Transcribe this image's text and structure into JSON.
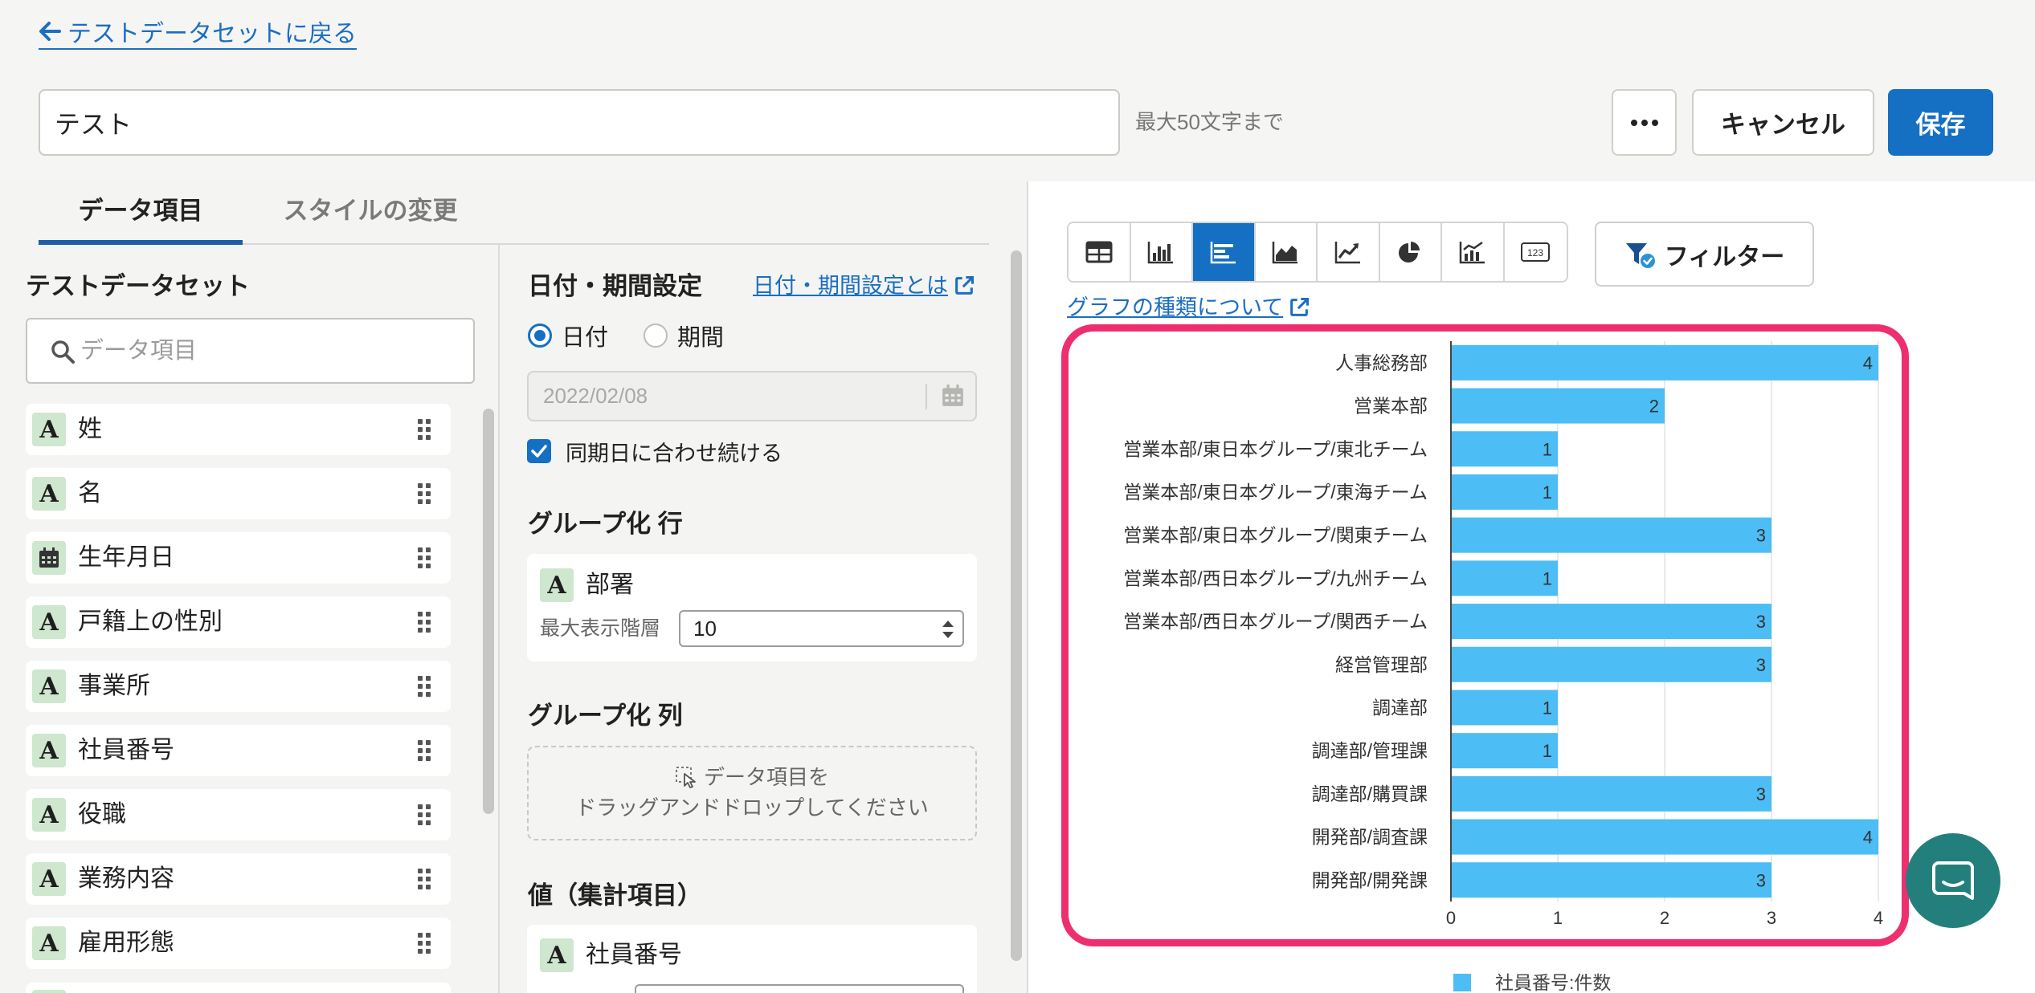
{
  "header": {
    "back_link": "テストデータセットに戻る",
    "title_value": "テスト",
    "title_hint": "最大50文字まで",
    "cancel_label": "キャンセル",
    "save_label": "保存"
  },
  "tabs": [
    {
      "label": "データ項目",
      "active": true
    },
    {
      "label": "スタイルの変更",
      "active": false
    }
  ],
  "dataset": {
    "title": "テストデータセット",
    "search_placeholder": "データ項目",
    "icon_letter": "A",
    "fields": [
      {
        "label": "姓",
        "icon": "text-type-icon"
      },
      {
        "label": "名",
        "icon": "text-type-icon"
      },
      {
        "label": "生年月日",
        "icon": "calendar-icon"
      },
      {
        "label": "戸籍上の性別",
        "icon": "text-type-icon"
      },
      {
        "label": "事業所",
        "icon": "text-type-icon"
      },
      {
        "label": "社員番号",
        "icon": "text-type-icon"
      },
      {
        "label": "役職",
        "icon": "text-type-icon"
      },
      {
        "label": "業務内容",
        "icon": "text-type-icon"
      },
      {
        "label": "雇用形態",
        "icon": "text-type-icon"
      }
    ]
  },
  "settings": {
    "date_title": "日付・期間設定",
    "date_help_link": "日付・期間設定とは",
    "radio_date": "日付",
    "radio_period": "期間",
    "selected_mode": "日付",
    "date_value": "2022/02/08",
    "sync_label": "同期日に合わせ続ける",
    "sync_checked": true,
    "group_row_title": "グループ化 行",
    "group_row_field": "部署",
    "max_level_label": "最大表示階層",
    "max_level_value": "10",
    "group_col_title": "グループ化 列",
    "drop_hint_line1": "データ項目を",
    "drop_hint_line2": "ドラッグアンドドロップしてください",
    "values_title": "値（集計項目）",
    "value_field": "社員番号"
  },
  "toolbar": {
    "chart_types": [
      "table-icon",
      "column-chart-icon",
      "bar-chart-icon",
      "area-chart-icon",
      "line-chart-icon",
      "pie-chart-icon",
      "combo-chart-icon",
      "number-icon"
    ],
    "active_chart_type": "bar-chart-icon",
    "number_icon_text": "123",
    "filter_label": "フィルター",
    "chart_type_help_link": "グラフの種類について"
  },
  "colors": {
    "accent": "#1570c4",
    "link": "#1b6ec2",
    "bar": "#4cbdf5",
    "highlight_frame": "#ee2f6e",
    "field_icon_bg": "#cfe6cf",
    "chat_button": "#227f7c"
  },
  "chart_data": {
    "type": "bar",
    "orientation": "horizontal",
    "categories": [
      "人事総務部",
      "営業本部",
      "営業本部/東日本グループ/東北チーム",
      "営業本部/東日本グループ/東海チーム",
      "営業本部/東日本グループ/関東チーム",
      "営業本部/西日本グループ/九州チーム",
      "営業本部/西日本グループ/関西チーム",
      "経営管理部",
      "調達部",
      "調達部/管理課",
      "調達部/購買課",
      "開発部/調査課",
      "開発部/開発課"
    ],
    "series": [
      {
        "name": "社員番号:件数",
        "values": [
          4,
          2,
          1,
          1,
          3,
          1,
          3,
          3,
          1,
          1,
          3,
          4,
          3
        ]
      }
    ],
    "xlim": [
      0,
      4
    ],
    "xticks": [
      0,
      1,
      2,
      3,
      4
    ],
    "data_labels": true,
    "grid": true,
    "legend": "bottom",
    "bar_color": "#4cbdf5"
  }
}
